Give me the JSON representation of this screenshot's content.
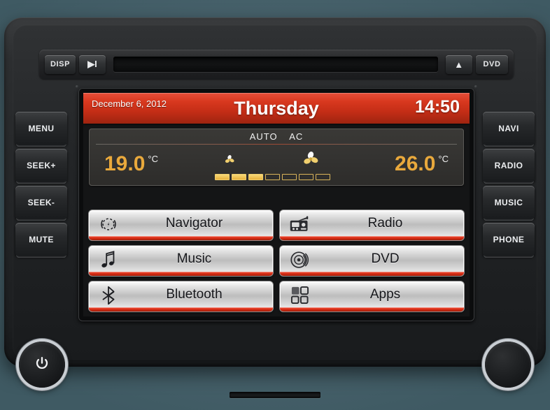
{
  "device": {
    "name": "car-infotainment-head-unit",
    "background_color": "#4c6670",
    "accent_color": "#d42a12",
    "temp_color": "#e9a93c"
  },
  "topbar": {
    "disp_label": "DISP",
    "play_label": "▶I",
    "eject_label": "▲",
    "dvd_label": "DVD",
    "slot_name": "disc-slot"
  },
  "screen": {
    "header": {
      "date": "December 6, 2012",
      "day": "Thursday",
      "time": "14:50"
    },
    "climate": {
      "mode_auto": "AUTO",
      "mode_ac": "AC",
      "left_temp": "19.0",
      "left_unit": "°C",
      "right_temp": "26.0",
      "right_unit": "°C",
      "fan_total_segments": 7,
      "fan_active_segments": 3
    },
    "menu": [
      {
        "label": "Navigator",
        "icon": "compass-icon"
      },
      {
        "label": "Radio",
        "icon": "radio-icon"
      },
      {
        "label": "Music",
        "icon": "music-note-icon"
      },
      {
        "label": "DVD",
        "icon": "disc-icon"
      },
      {
        "label": "Bluetooth",
        "icon": "bluetooth-icon"
      },
      {
        "label": "Apps",
        "icon": "grid-apps-icon"
      }
    ]
  },
  "left_buttons": [
    {
      "label": "MENU"
    },
    {
      "label": "SEEK+"
    },
    {
      "label": "SEEK-"
    },
    {
      "label": "MUTE"
    }
  ],
  "right_buttons": [
    {
      "label": "NAVI"
    },
    {
      "label": "RADIO"
    },
    {
      "label": "MUSIC"
    },
    {
      "label": "PHONE"
    }
  ],
  "knobs": {
    "left": {
      "icon": "power-icon"
    },
    "right": {
      "icon": "blank-knob-icon"
    }
  }
}
